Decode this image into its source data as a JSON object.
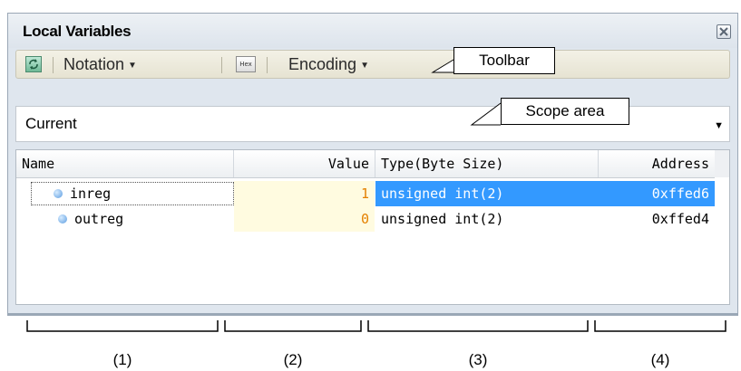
{
  "window": {
    "title": "Local Variables"
  },
  "toolbar": {
    "refresh_icon": "refresh-icon",
    "notation_label": "Notation",
    "hex_icon_text": "Hex",
    "encoding_label": "Encoding"
  },
  "scope": {
    "value": "Current"
  },
  "table": {
    "columns": [
      "Name",
      "Value",
      "Type(Byte Size)",
      "Address"
    ],
    "rows": [
      {
        "name": "inreg",
        "value": "1",
        "type": "unsigned int(2)",
        "address": "0xffed6"
      },
      {
        "name": "outreg",
        "value": "0",
        "type": "unsigned int(2)",
        "address": "0xffed4"
      }
    ]
  },
  "callouts": {
    "toolbar": "Toolbar",
    "scope": "Scope area"
  },
  "brackets": [
    "(1)",
    "(2)",
    "(3)",
    "(4)"
  ],
  "colors": {
    "selection": "#3399ff",
    "value_bg": "#fffbe0",
    "value_text": "#e48000"
  }
}
